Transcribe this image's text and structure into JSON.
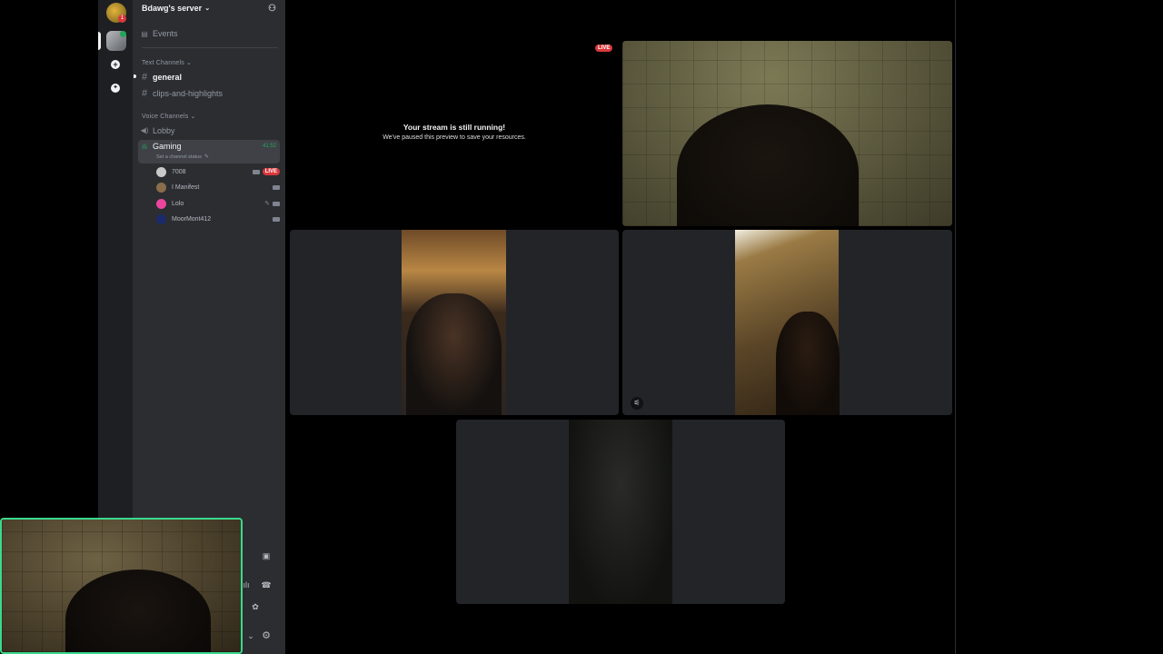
{
  "server": {
    "name": "Bdawg's server",
    "badge_count": "1"
  },
  "sidebar": {
    "events_label": "Events",
    "text_category": "Text Channels",
    "text_channels": [
      "general",
      "clips-and-highlights"
    ],
    "voice_category": "Voice Channels",
    "lobby_label": "Lobby",
    "active_voice": {
      "name": "Gaming",
      "timer": "41:52",
      "status_placeholder": "Set a channel status"
    },
    "participants": [
      {
        "name": "7008",
        "live": "LIVE"
      },
      {
        "name": "I Manifest"
      },
      {
        "name": "Lolo"
      },
      {
        "name": "MoorMont412"
      }
    ]
  },
  "stage": {
    "live_badge": "LIVE",
    "stream_title": "Your stream is still running!",
    "stream_subtitle": "We've paused this preview to save your resources."
  },
  "colors": {
    "accent_green": "#23a55a",
    "live_red": "#da373c",
    "speaking_ring": "#3bd98e"
  }
}
